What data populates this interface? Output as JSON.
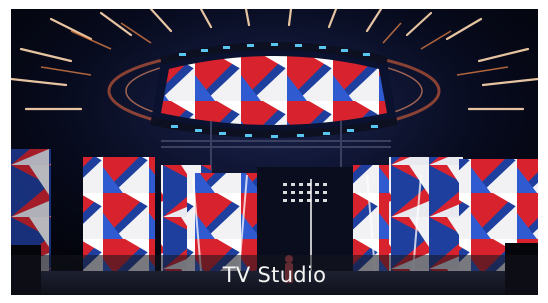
{
  "caption": {
    "text": "TV Studio"
  },
  "photo": {
    "subject": "tv-studio-stage",
    "colors": {
      "red": "#d8232e",
      "blue": "#1f3f9e",
      "white": "#f2f2f5",
      "light": "#58c6f0"
    }
  }
}
